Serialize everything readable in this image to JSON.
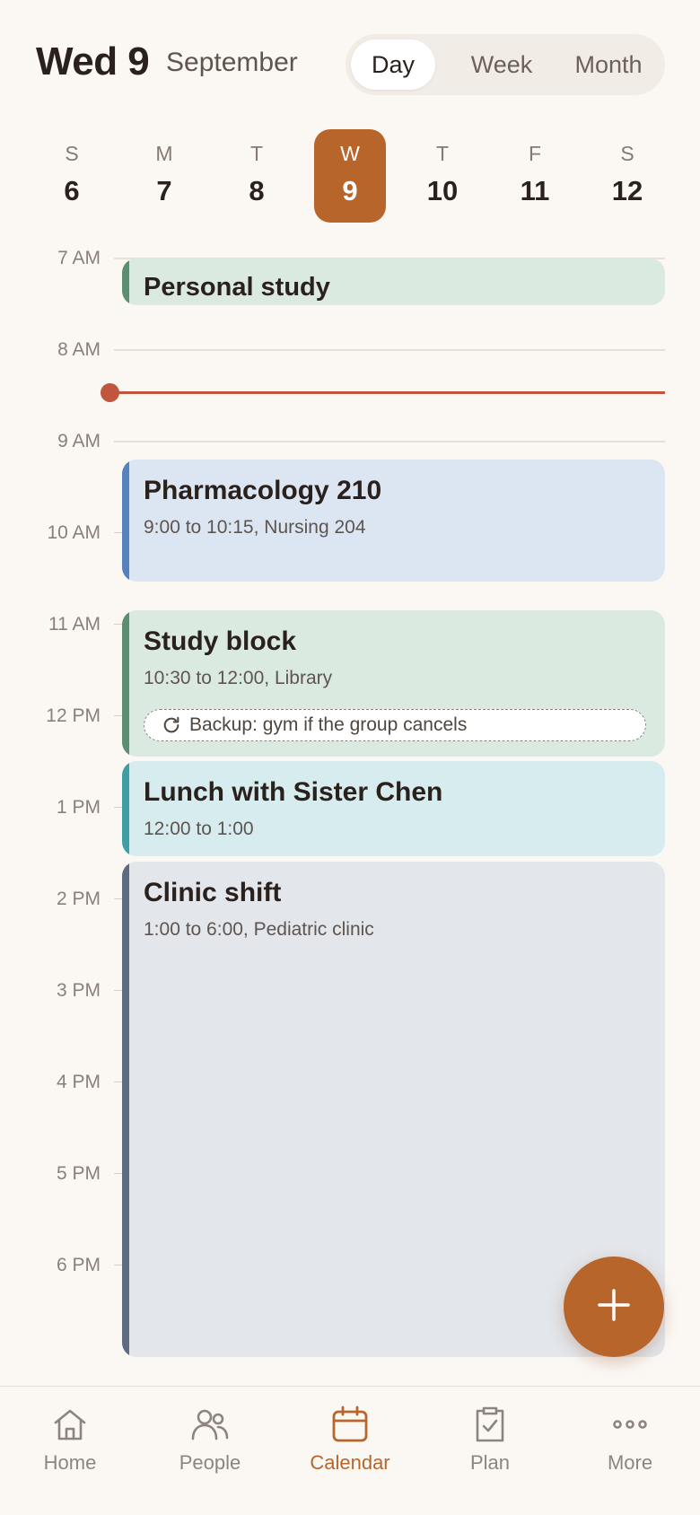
{
  "header": {
    "date": "Wed 9",
    "month": "September"
  },
  "view_switch": {
    "options": [
      "Day",
      "Week",
      "Month"
    ],
    "selected": "Day"
  },
  "week": [
    {
      "letter": "S",
      "num": "6"
    },
    {
      "letter": "M",
      "num": "7"
    },
    {
      "letter": "T",
      "num": "8"
    },
    {
      "letter": "W",
      "num": "9",
      "selected": true
    },
    {
      "letter": "T",
      "num": "10"
    },
    {
      "letter": "F",
      "num": "11"
    },
    {
      "letter": "S",
      "num": "12"
    }
  ],
  "hours": [
    "7 AM",
    "8 AM",
    "9 AM",
    "10 AM",
    "11 AM",
    "12 PM",
    "1 PM",
    "2 PM",
    "3 PM",
    "4 PM",
    "5 PM",
    "6 PM"
  ],
  "events": {
    "personal": {
      "title": "Personal study"
    },
    "pharma": {
      "title": "Pharmacology 210",
      "detail": "9:00 to 10:15, Nursing 204"
    },
    "study": {
      "title": "Study block",
      "detail": "10:30 to 12:00, Library",
      "backup": "Backup: gym if the group cancels"
    },
    "lunch": {
      "title": "Lunch with Sister Chen",
      "detail": "12:00 to 1:00"
    },
    "clinic": {
      "title": "Clinic shift",
      "detail": "1:00 to 6:00, Pediatric clinic"
    }
  },
  "colors": {
    "accent": "#b8652c",
    "now_line": "#c0563d",
    "green": "#5c8e72",
    "blue": "#5582bb",
    "teal": "#3f9ea3",
    "slate": "#5d6b80"
  },
  "nav": {
    "home": {
      "label": "Home",
      "icon": "home-icon"
    },
    "people": {
      "label": "People",
      "icon": "people-icon"
    },
    "calendar": {
      "label": "Calendar",
      "icon": "calendar-icon",
      "active": true
    },
    "plan": {
      "label": "Plan",
      "icon": "clipboard-check-icon"
    },
    "more": {
      "label": "More",
      "icon": "more-icon"
    }
  },
  "fab": {
    "icon": "plus-icon"
  }
}
